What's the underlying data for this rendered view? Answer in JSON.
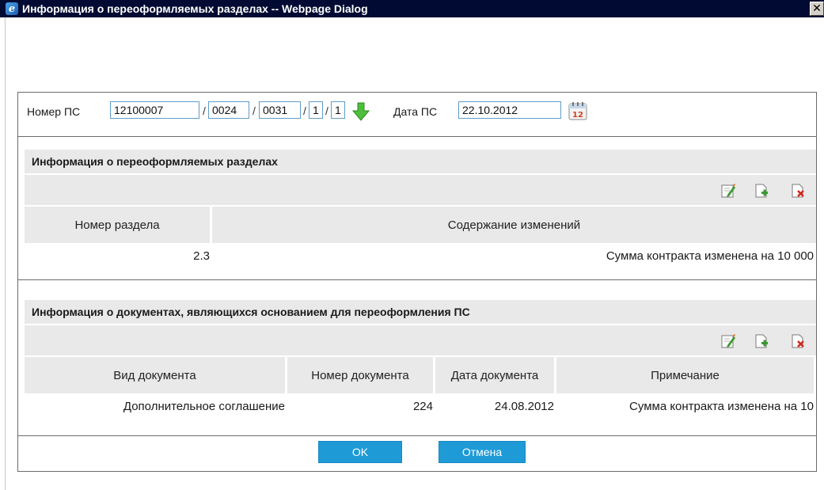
{
  "window": {
    "title": "Информация о переоформляемых разделах -- Webpage Dialog",
    "close_glyph": "✕"
  },
  "ps": {
    "number_label": "Номер ПС",
    "part1": "12100007",
    "part2": "0024",
    "part3": "0031",
    "part4": "1",
    "part5": "1",
    "date_label": "Дата ПС",
    "date_value": "22.10.2012",
    "calendar_icon_text": "12"
  },
  "sections_block": {
    "header": "Информация о переоформляемых разделах",
    "columns": [
      "Номер раздела",
      "Содержание изменений"
    ],
    "rows": [
      {
        "section_number": "2.3",
        "changes": "Сумма контракта изменена на 10 000"
      }
    ]
  },
  "documents_block": {
    "header": "Информация о документах, являющихся основанием для переоформления ПС",
    "columns": [
      "Вид документа",
      "Номер документа",
      "Дата документа",
      "Примечание"
    ],
    "rows": [
      {
        "doc_type": "Дополнительное соглашение",
        "doc_number": "224",
        "doc_date": "24.08.2012",
        "note": "Сумма контракта изменена на 10"
      }
    ]
  },
  "buttons": {
    "ok": "OK",
    "cancel": "Отмена"
  },
  "icons": {
    "edit": "edit-icon",
    "add": "add-icon",
    "delete": "delete-icon",
    "arrow": "down-arrow-icon",
    "calendar": "calendar-icon",
    "browser": "ie-icon"
  },
  "colors": {
    "titlebar": "#000a32",
    "button": "#1e9bd7",
    "input_border": "#5f9cc8",
    "header_bg": "#e9e9e9"
  }
}
